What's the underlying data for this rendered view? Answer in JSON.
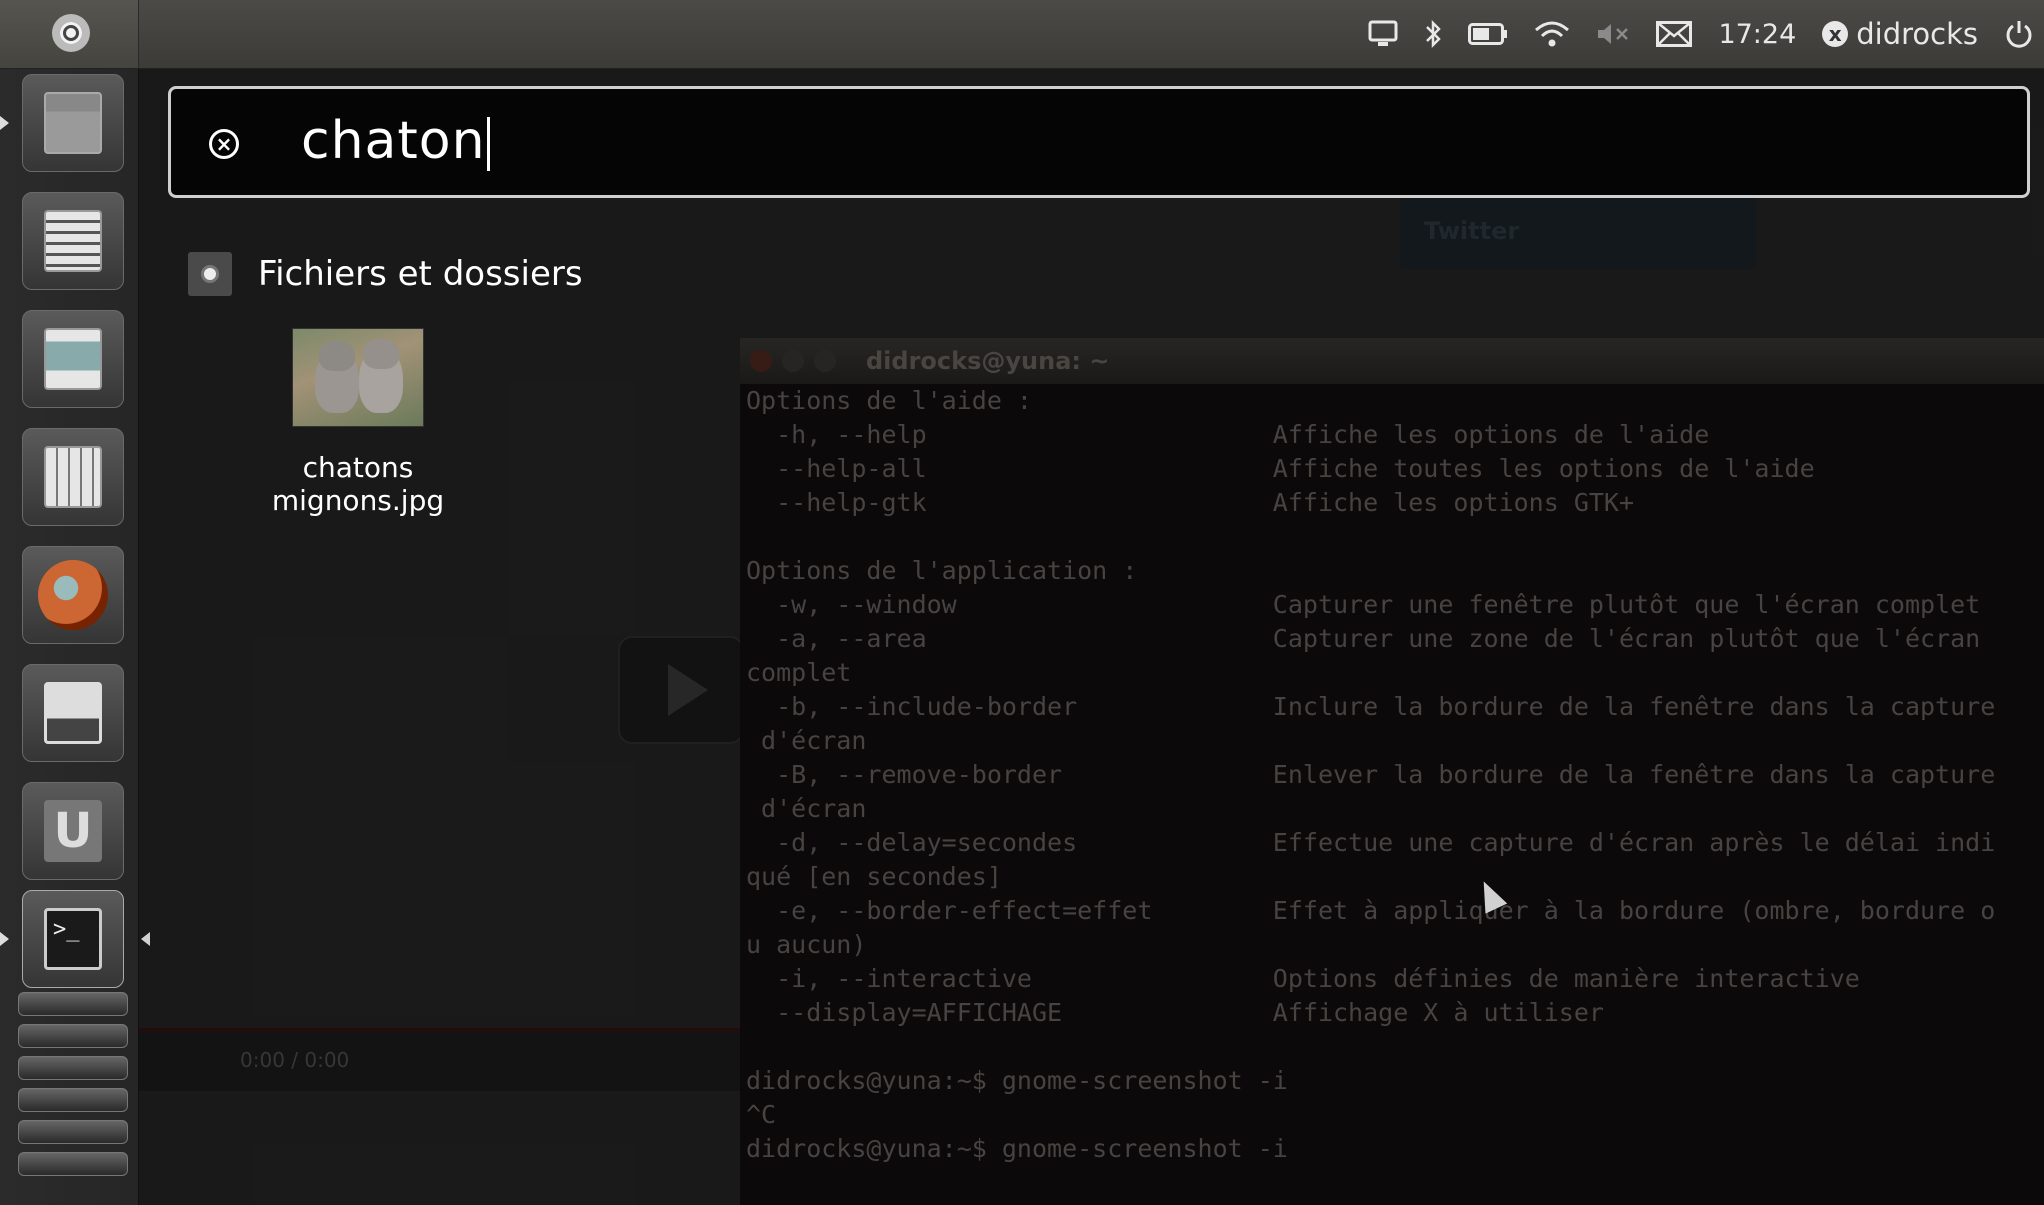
{
  "top_panel": {
    "clock": "17:24",
    "user": "didrocks",
    "user_badge": "x",
    "icons": [
      "computer-icon",
      "bluetooth-icon",
      "battery-icon",
      "wifi-icon",
      "volume-muted-icon",
      "mail-icon",
      "power-icon"
    ]
  },
  "launcher": {
    "items": [
      "home-folder",
      "libreoffice-writer",
      "libreoffice-impress",
      "libreoffice-calc",
      "firefox",
      "shotwell",
      "ubuntu-one",
      "terminal",
      "chromium",
      "workspaces",
      "trash"
    ]
  },
  "dash": {
    "search_query": "chaton",
    "category": "Fichiers et dossiers",
    "results": [
      {
        "label": "chatons mignons.jpg",
        "type": "image"
      }
    ]
  },
  "background": {
    "terminal_title": "didrocks@yuna: ~",
    "terminal_lines": [
      "Options de l'aide :",
      "  -h, --help                       Affiche les options de l'aide",
      "  --help-all                       Affiche toutes les options de l'aide",
      "  --help-gtk                       Affiche les options GTK+",
      "",
      "Options de l'application :",
      "  -w, --window                     Capturer une fenêtre plutôt que l'écran complet",
      "  -a, --area                       Capturer une zone de l'écran plutôt que l'écran",
      "complet",
      "  -b, --include-border             Inclure la bordure de la fenêtre dans la capture",
      " d'écran",
      "  -B, --remove-border              Enlever la bordure de la fenêtre dans la capture",
      " d'écran",
      "  -d, --delay=secondes             Effectue une capture d'écran après le délai indi",
      "qué [en secondes]",
      "  -e, --border-effect=effet        Effet à appliquer à la bordure (ombre, bordure o",
      "u aucun)",
      "  -i, --interactive                Options définies de manière interactive",
      "  --display=AFFICHAGE              Affichage X à utiliser",
      "",
      "didrocks@yuna:~$ gnome-screenshot -i",
      "^C",
      "didrocks@yuna:~$ gnome-screenshot -i"
    ],
    "player_time": "0:00 / 0:00",
    "twitter_label": "Twitter"
  }
}
